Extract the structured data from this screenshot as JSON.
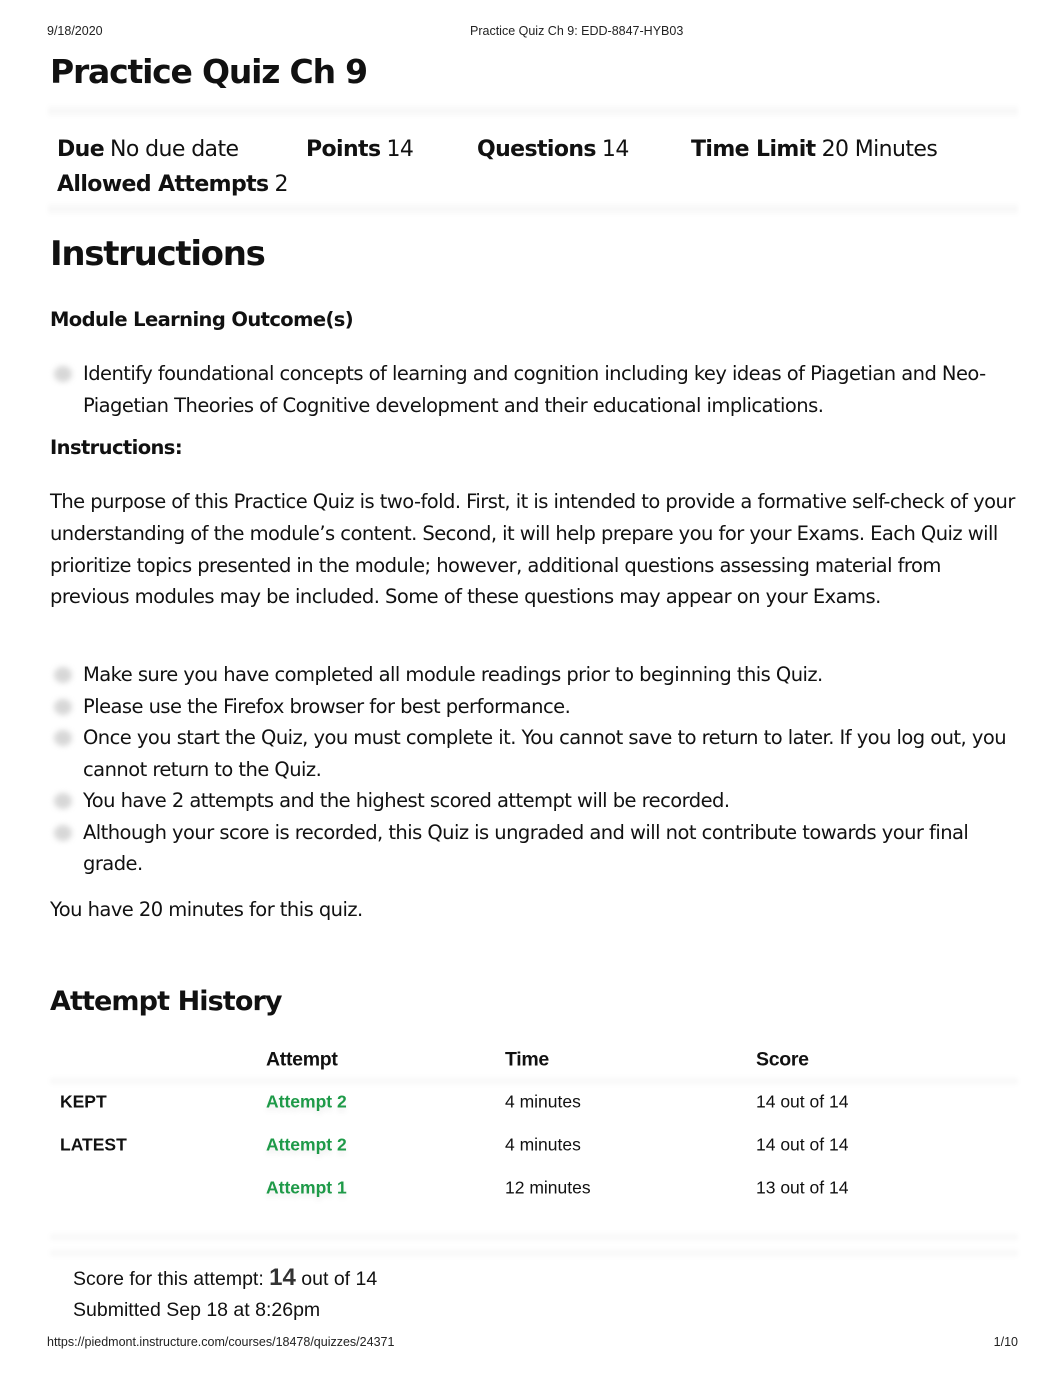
{
  "print_header": {
    "date": "9/18/2020",
    "title": "Practice Quiz Ch 9: EDD-8847-HYB03"
  },
  "page_title": "Practice Quiz Ch 9",
  "quiz_meta": {
    "due": {
      "label": "Due",
      "value": "No due date"
    },
    "points": {
      "label": "Points",
      "value": "14"
    },
    "questions": {
      "label": "Questions",
      "value": "14"
    },
    "time_limit": {
      "label": "Time Limit",
      "value": "20 Minutes"
    },
    "allowed_attempts": {
      "label": "Allowed Attempts",
      "value": "2"
    }
  },
  "instructions": {
    "heading": "Instructions",
    "outcomes_heading": "Module Learning Outcome(s)",
    "outcomes": [
      "Identify foundational concepts of learning and cognition including key ideas of Piagetian and Neo-Piagetian Theories of Cognitive development and their educational implications."
    ],
    "sub_heading": "Instructions:",
    "purpose": "The purpose of this Practice Quiz is two-fold. First, it is intended to provide a formative self-check of your understanding of the module’s content. Second, it will help prepare you for your Exams. Each Quiz will prioritize topics presented in the module; however, additional questions assessing material from previous modules may be included. Some of these questions may appear on your Exams.",
    "rules": [
      "Make sure you have completed all module readings prior to beginning this Quiz.",
      "Please use the Firefox browser for best performance.",
      "Once you start the Quiz, you must complete it. You cannot save to return to later. If you log out, you cannot return to the Quiz.",
      "You have 2 attempts and the highest scored attempt will be recorded.",
      "Although your score is recorded, this Quiz is ungraded and will not contribute towards your final grade."
    ],
    "time_note": "You have 20 minutes for this quiz."
  },
  "attempt_history": {
    "heading": "Attempt History",
    "columns": [
      "",
      "Attempt",
      "Time",
      "Score"
    ],
    "rows": [
      {
        "label": "KEPT",
        "attempt": "Attempt 2",
        "time": "4 minutes",
        "score": "14 out of 14"
      },
      {
        "label": "LATEST",
        "attempt": "Attempt 2",
        "time": "4 minutes",
        "score": "14 out of 14"
      },
      {
        "label": "",
        "attempt": "Attempt 1",
        "time": "12 minutes",
        "score": "13 out of 14"
      }
    ],
    "link_color": "#1e9a48"
  },
  "score_summary": {
    "prefix": "Score for this attempt:",
    "score": "14",
    "suffix": "out of 14",
    "submitted": "Submitted Sep 18 at 8:26pm"
  },
  "print_footer": {
    "url": "https://piedmont.instructure.com/courses/18478/quizzes/24371",
    "page": "1/10"
  }
}
